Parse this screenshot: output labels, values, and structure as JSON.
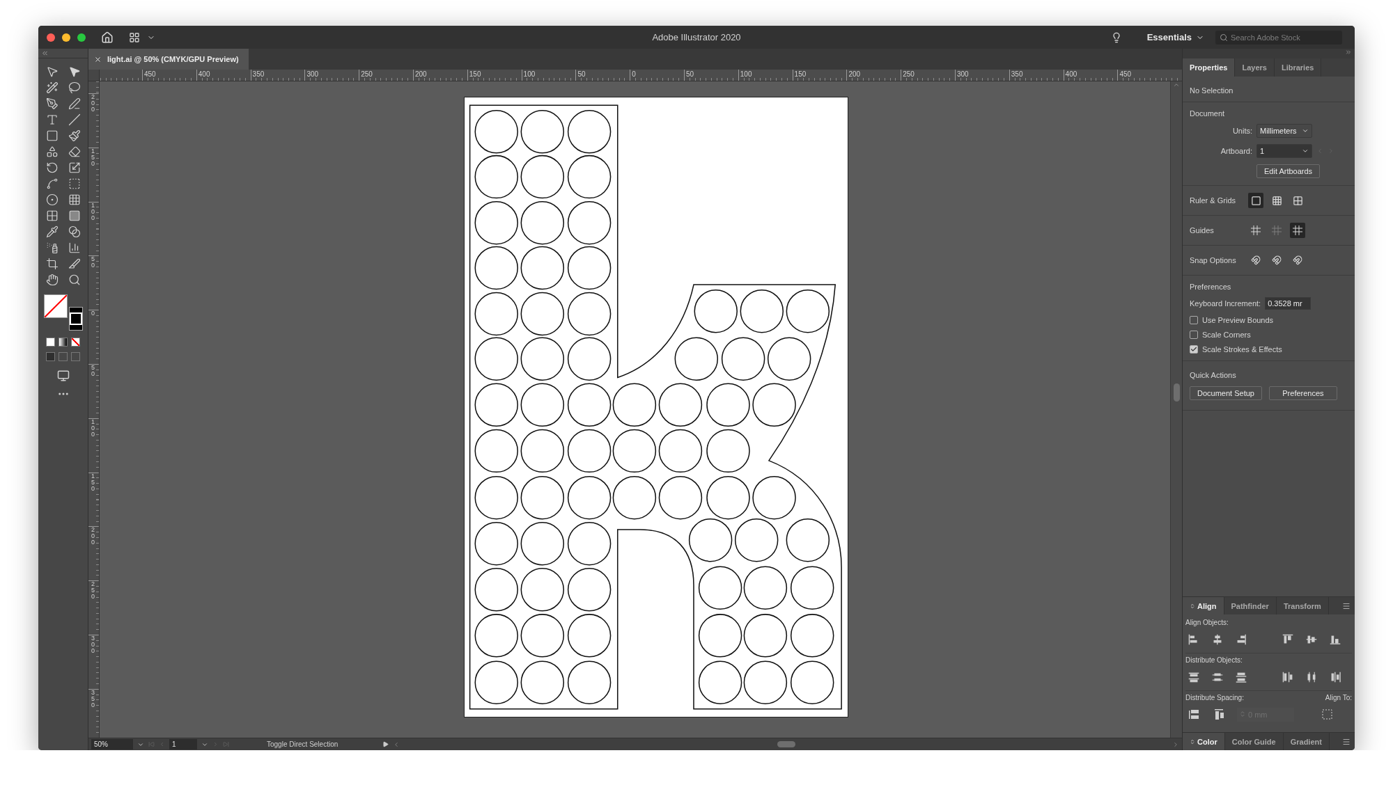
{
  "window": {
    "title": "Adobe Illustrator 2020"
  },
  "header": {
    "workspace": "Essentials",
    "search": {
      "placeholder": "Search Adobe Stock"
    }
  },
  "document_tab": {
    "label": "light.ai @ 50% (CMYK/GPU Preview)"
  },
  "rulers": {
    "horizontal": [
      "450",
      "400",
      "350",
      "300",
      "250",
      "200",
      "150",
      "100",
      "50",
      "0",
      "50",
      "100",
      "150",
      "200",
      "250",
      "300",
      "350",
      "400",
      "450"
    ],
    "vertical": [
      "200",
      "150",
      "100",
      "50",
      "0",
      "50",
      "100",
      "150",
      "200",
      "250",
      "300",
      "350"
    ]
  },
  "properties_panel": {
    "tabs": [
      {
        "label": "Properties",
        "selected": true
      },
      {
        "label": "Layers",
        "selected": false
      },
      {
        "label": "Libraries",
        "selected": false
      }
    ],
    "selection": "No Selection",
    "document": {
      "heading": "Document",
      "units_label": "Units:",
      "units_value": "Millimeters",
      "artboard_label": "Artboard:",
      "artboard_value": "1",
      "edit_button": "Edit Artboards"
    },
    "ruler_grids": {
      "label": "Ruler & Grids",
      "buttons": [
        {
          "on": true
        },
        {
          "on": false
        },
        {
          "on": false
        }
      ]
    },
    "guides": {
      "label": "Guides",
      "buttons": [
        {
          "on": false,
          "disabled": false
        },
        {
          "on": false,
          "disabled": true
        },
        {
          "on": true,
          "disabled": false
        }
      ]
    },
    "snap": {
      "label": "Snap Options"
    },
    "preferences": {
      "heading": "Preferences",
      "increment_label": "Keyboard Increment:",
      "increment_value": "0.3528 mr",
      "options": [
        {
          "label": "Use Preview Bounds",
          "checked": false
        },
        {
          "label": "Scale Corners",
          "checked": false
        },
        {
          "label": "Scale Strokes & Effects",
          "checked": true
        }
      ]
    },
    "quick_actions": {
      "heading": "Quick Actions",
      "buttons": [
        "Document Setup",
        "Preferences"
      ]
    }
  },
  "align_panel": {
    "tabs": [
      {
        "label": "Align",
        "selected": true
      },
      {
        "label": "Pathfinder",
        "selected": false
      },
      {
        "label": "Transform",
        "selected": false
      }
    ],
    "align_objects": "Align Objects:",
    "distribute_objects": "Distribute Objects:",
    "distribute_spacing": "Distribute Spacing:",
    "spacing_placeholder": "0 mm",
    "align_to": "Align To:"
  },
  "color_panel": {
    "tabs": [
      {
        "label": "Color",
        "selected": true
      },
      {
        "label": "Color Guide",
        "selected": false
      },
      {
        "label": "Gradient",
        "selected": false
      }
    ]
  },
  "status_bar": {
    "zoom": "50%",
    "artboard": "1",
    "tool": "Toggle Direct Selection"
  }
}
